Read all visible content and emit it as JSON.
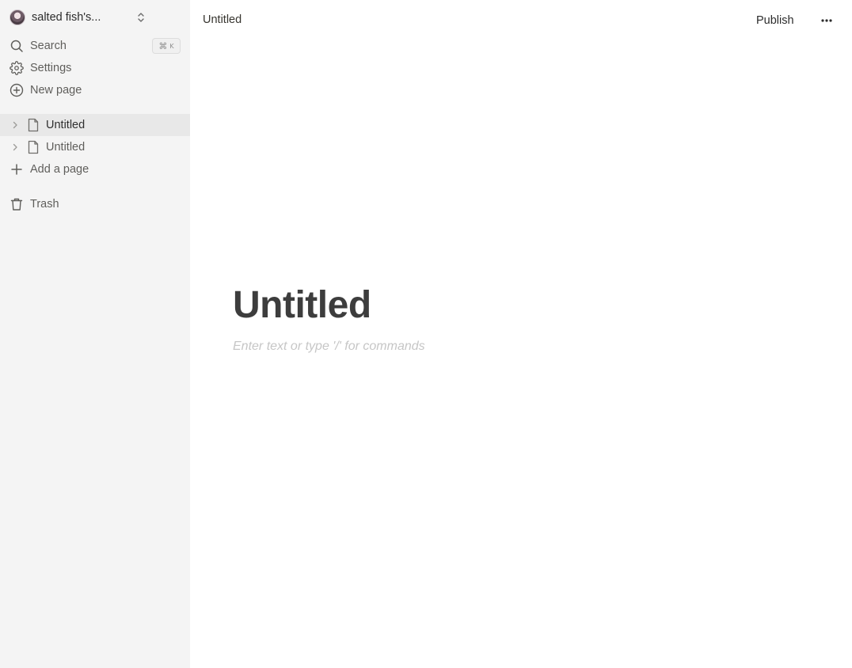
{
  "sidebar": {
    "workspace": {
      "name": "salted fish's..."
    },
    "search": {
      "label": "Search",
      "shortcut_symbol": "⌘",
      "shortcut_key": "K"
    },
    "settings": {
      "label": "Settings"
    },
    "new_page": {
      "label": "New page"
    },
    "pages": [
      {
        "label": "Untitled",
        "active": true
      },
      {
        "label": "Untitled",
        "active": false
      }
    ],
    "add_page": {
      "label": "Add a page"
    },
    "trash": {
      "label": "Trash"
    }
  },
  "topbar": {
    "title": "Untitled",
    "publish_label": "Publish"
  },
  "editor": {
    "title": "Untitled",
    "placeholder": "Enter text or type '/' for commands"
  },
  "icons": {
    "workspace": "avatar",
    "switcher": "chevron-up-down-icon",
    "search": "search-icon",
    "settings": "gear-icon",
    "new_page": "plus-circle-icon",
    "page": "document-icon",
    "expand": "chevron-right-icon",
    "add": "plus-icon",
    "trash": "trash-icon",
    "more": "ellipsis-icon"
  }
}
